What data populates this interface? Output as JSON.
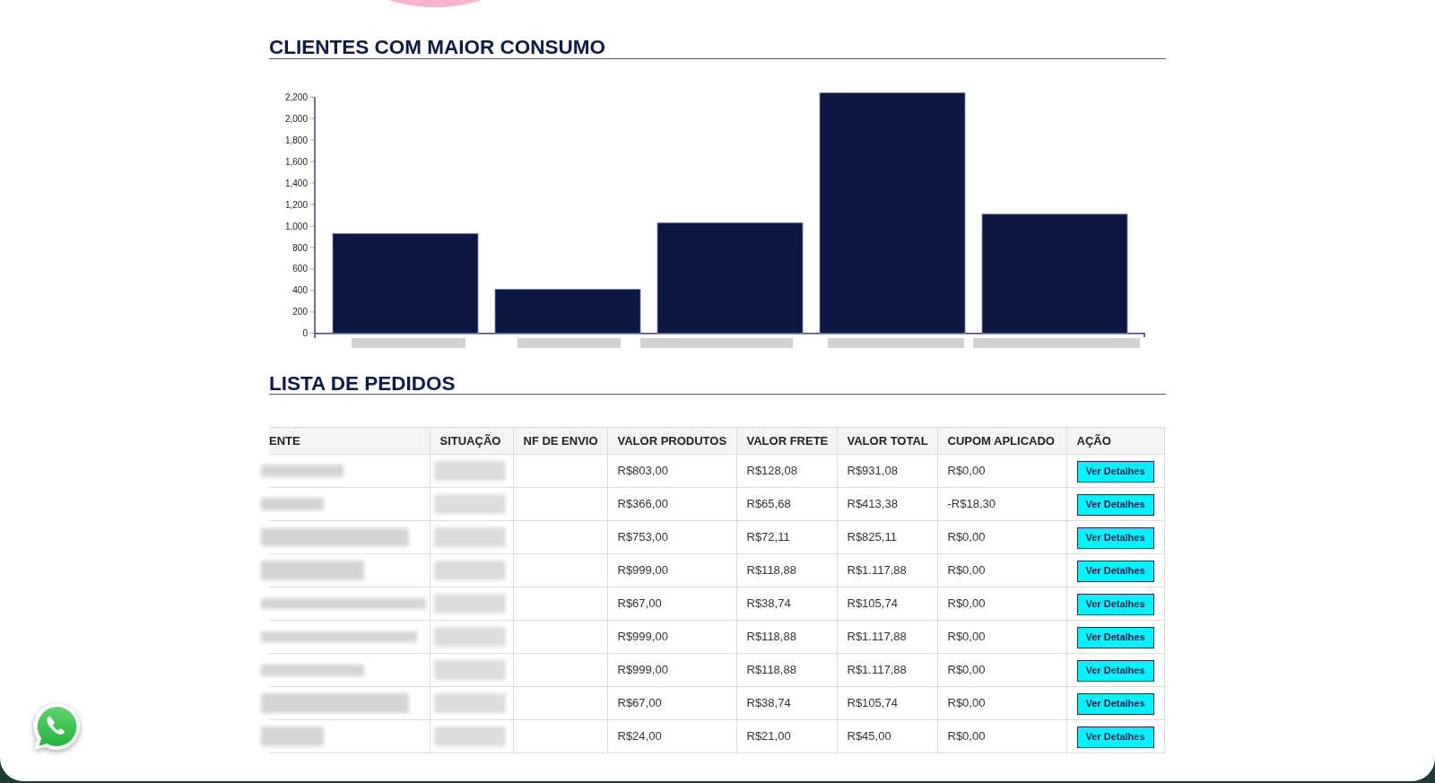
{
  "consumption": {
    "title": "CLIENTES COM MAIOR CONSUMO",
    "chart_data": {
      "type": "bar",
      "ylim": [
        0,
        2250
      ],
      "yticks": [
        0,
        200,
        400,
        600,
        800,
        {
          "value": 1000,
          "label": "1,000"
        },
        {
          "value": 1200,
          "label": "1,200"
        },
        {
          "value": 1400,
          "label": "1,400"
        },
        {
          "value": 1600,
          "label": "1,600"
        },
        {
          "value": 1800,
          "label": "1,800"
        },
        {
          "value": 2000,
          "label": "2,000"
        },
        {
          "value": 2200,
          "label": "2,200"
        }
      ],
      "series": [
        {
          "color": "#0c1842",
          "values": [
            930,
            410,
            1030,
            2240,
            1110
          ]
        }
      ]
    }
  },
  "orders": {
    "title": "LISTA DE PEDIDOS",
    "columns": [
      "ENTE",
      "SITUAÇÃO",
      "NF DE ENVIO",
      "VALOR PRODUTOS",
      "VALOR FRETE",
      "VALOR TOTAL",
      "CUPOM APLICADO",
      "AÇÃO"
    ],
    "rows": [
      {
        "valor_produtos": "R$803,00",
        "valor_frete": "R$128,08",
        "valor_total": "R$931,08",
        "cupom_aplicado": "R$0,00",
        "action": "Ver Detalhes"
      },
      {
        "valor_produtos": "R$366,00",
        "valor_frete": "R$65,68",
        "valor_total": "R$413,38",
        "cupom_aplicado": "-R$18,30",
        "action": "Ver Detalhes"
      },
      {
        "valor_produtos": "R$753,00",
        "valor_frete": "R$72,11",
        "valor_total": "R$825,11",
        "cupom_aplicado": "R$0,00",
        "action": "Ver Detalhes"
      },
      {
        "valor_produtos": "R$999,00",
        "valor_frete": "R$118,88",
        "valor_total": "R$1.117,88",
        "cupom_aplicado": "R$0,00",
        "action": "Ver Detalhes"
      },
      {
        "valor_produtos": "R$67,00",
        "valor_frete": "R$38,74",
        "valor_total": "R$105,74",
        "cupom_aplicado": "R$0,00",
        "action": "Ver Detalhes"
      },
      {
        "valor_produtos": "R$999,00",
        "valor_frete": "R$118,88",
        "valor_total": "R$1.117,88",
        "cupom_aplicado": "R$0,00",
        "action": "Ver Detalhes"
      },
      {
        "valor_produtos": "R$999,00",
        "valor_frete": "R$118,88",
        "valor_total": "R$1.117,88",
        "cupom_aplicado": "R$0,00",
        "action": "Ver Detalhes"
      },
      {
        "valor_produtos": "R$67,00",
        "valor_frete": "R$38,74",
        "valor_total": "R$105,74",
        "cupom_aplicado": "R$0,00",
        "action": "Ver Detalhes"
      },
      {
        "valor_produtos": "R$24,00",
        "valor_frete": "R$21,00",
        "valor_total": "R$45,00",
        "cupom_aplicado": "R$0,00",
        "action": "Ver Detalhes"
      }
    ]
  }
}
